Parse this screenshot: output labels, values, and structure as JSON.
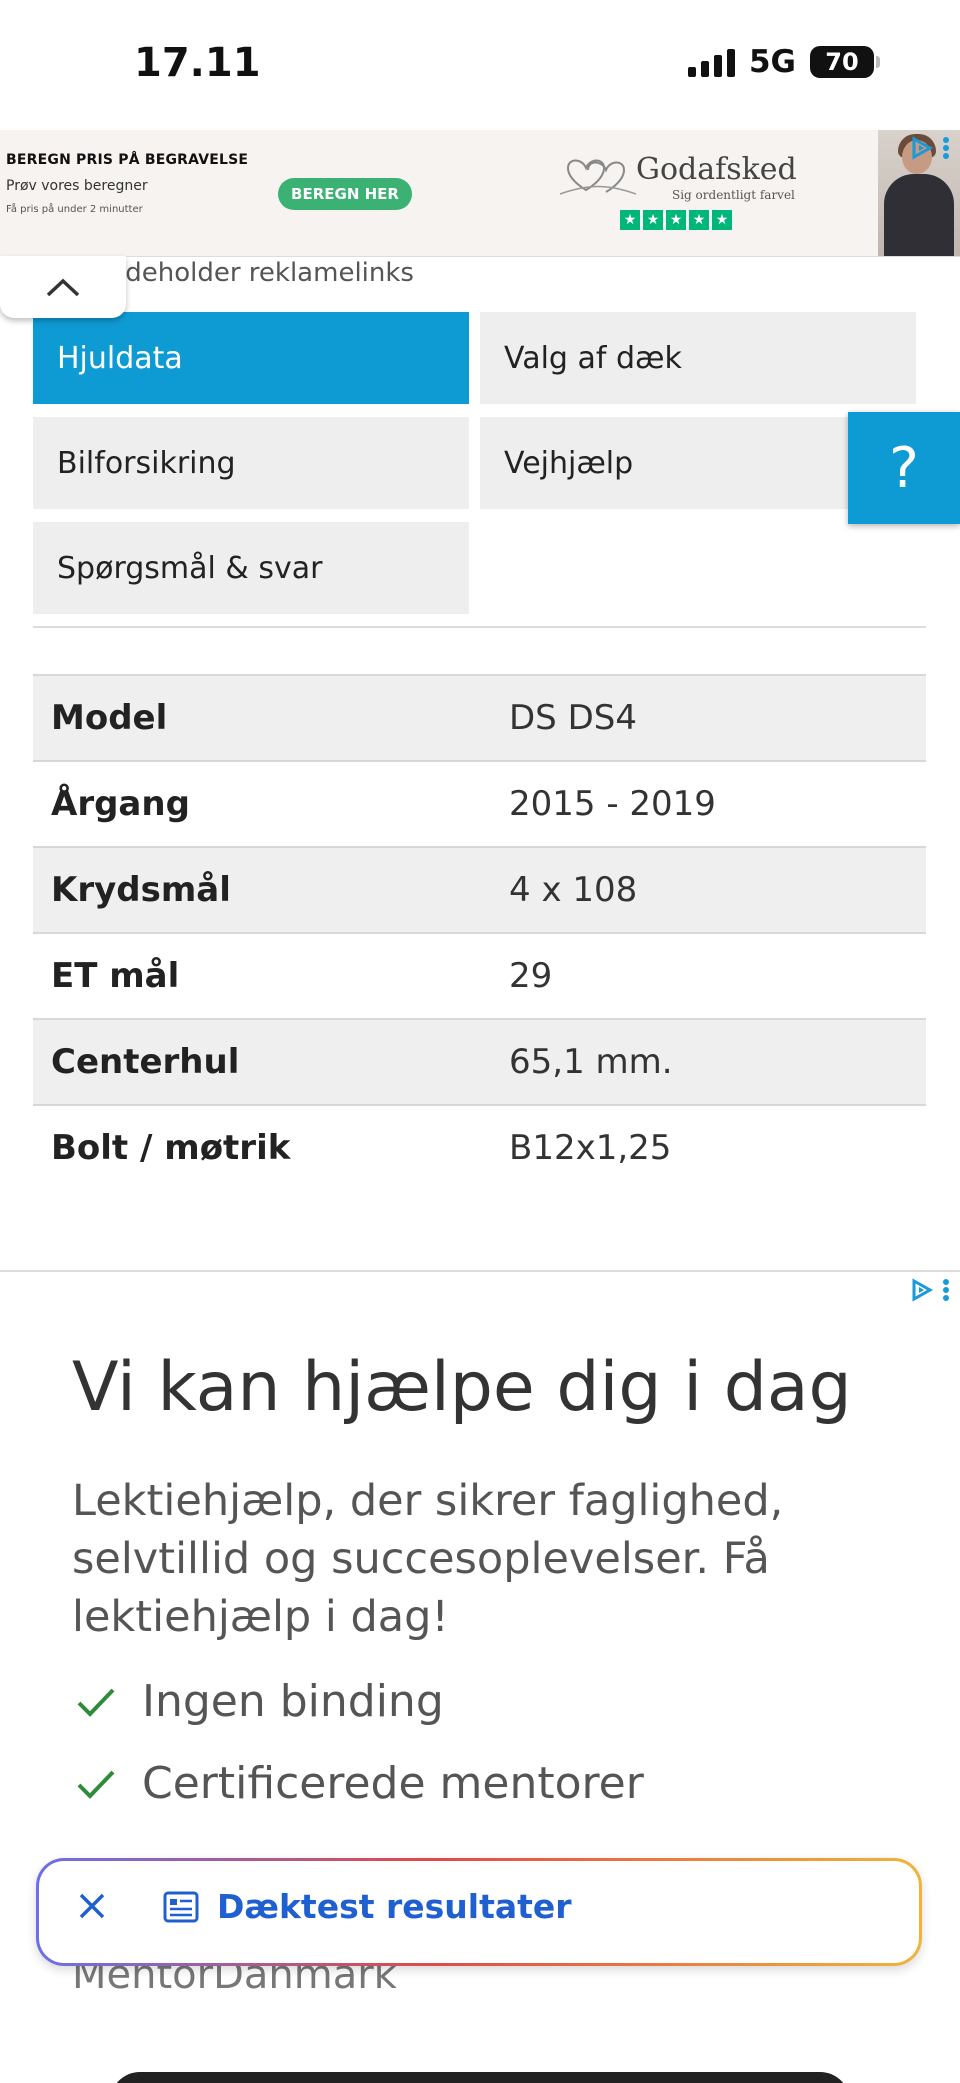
{
  "status_bar": {
    "time": "17.11",
    "network": "5G",
    "battery": "70"
  },
  "top_ad": {
    "title": "BEREGN PRIS PÅ BEGRAVELSE",
    "subtitle": "Prøv vores beregner",
    "small": "Få pris på under 2 minutter",
    "cta": "BEREGN HER",
    "brand": "Godafsked",
    "tagline": "Sig ordentligt farvel"
  },
  "ad_notice": "ıdeholder reklamelinks",
  "tabs": [
    {
      "label": "Hjuldata"
    },
    {
      "label": "Valg af dæk"
    },
    {
      "label": "Bilforsikring"
    },
    {
      "label": "Vejhjælp"
    },
    {
      "label": "Spørgsmål & svar"
    }
  ],
  "help_button": "?",
  "specs": [
    {
      "key": "Model",
      "value": "DS DS4"
    },
    {
      "key": "Årgang",
      "value": "2015 - 2019"
    },
    {
      "key": "Krydsmål",
      "value": "4 x 108"
    },
    {
      "key": "ET mål",
      "value": "29"
    },
    {
      "key": "Centerhul",
      "value": "65,1 mm."
    },
    {
      "key": "Bolt / møtrik",
      "value": "B12x1,25"
    }
  ],
  "bottom_ad": {
    "title": "Vi kan hjælpe dig i dag",
    "text": "Lektiehjælp, der sikrer faglighed, selvtillid og succesoplevelser. Få lektiehjælp i dag!",
    "checks": [
      "Ingen binding",
      "Certificerede mentorer"
    ],
    "brand": "MentorDanmark"
  },
  "floating_bar": {
    "label": "Dæktest resultater"
  },
  "colors": {
    "accent": "#0e9bd4",
    "check": "#2e8b3a",
    "link": "#1f5fcf"
  }
}
